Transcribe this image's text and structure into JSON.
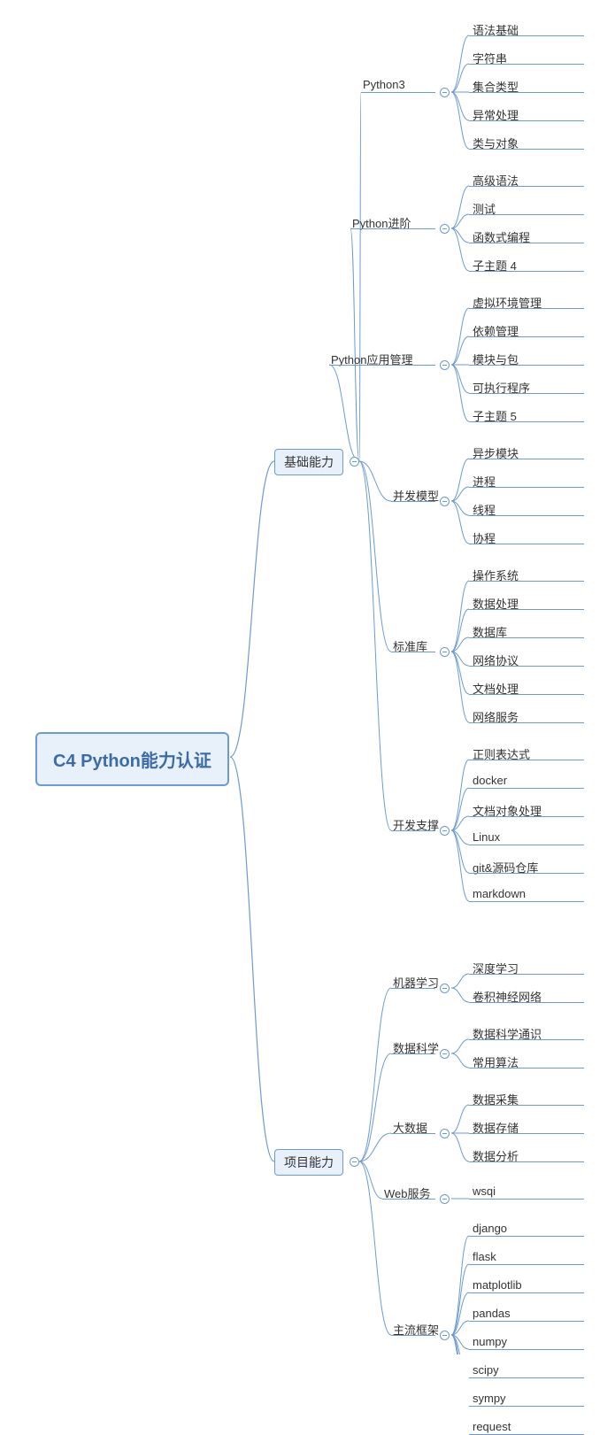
{
  "root": {
    "label": "C4 Python能力认证"
  },
  "branches": [
    {
      "label": "基础能力",
      "children": [
        {
          "label": "Python3",
          "children": [
            {
              "label": "语法基础"
            },
            {
              "label": "字符串"
            },
            {
              "label": "集合类型"
            },
            {
              "label": "异常处理"
            },
            {
              "label": "类与对象"
            }
          ]
        },
        {
          "label": "Python进阶",
          "children": [
            {
              "label": "高级语法"
            },
            {
              "label": "测试"
            },
            {
              "label": "函数式编程"
            },
            {
              "label": "子主题 4"
            }
          ]
        },
        {
          "label": "Python应用管理",
          "children": [
            {
              "label": "虚拟环境管理"
            },
            {
              "label": "依赖管理"
            },
            {
              "label": "模块与包"
            },
            {
              "label": "可执行程序"
            },
            {
              "label": "子主题 5"
            }
          ]
        },
        {
          "label": "并发模型",
          "children": [
            {
              "label": "异步模块"
            },
            {
              "label": "进程"
            },
            {
              "label": "线程"
            },
            {
              "label": "协程"
            }
          ]
        },
        {
          "label": "标准库",
          "children": [
            {
              "label": "操作系统"
            },
            {
              "label": "数据处理"
            },
            {
              "label": "数据库"
            },
            {
              "label": "网络协议"
            },
            {
              "label": "文档处理"
            },
            {
              "label": "网络服务"
            }
          ]
        },
        {
          "label": "开发支撑",
          "children": [
            {
              "label": "正则表达式"
            },
            {
              "label": "docker"
            },
            {
              "label": "文档对象处理"
            },
            {
              "label": "Linux"
            },
            {
              "label": "git&源码仓库"
            },
            {
              "label": "markdown"
            }
          ]
        }
      ]
    },
    {
      "label": "项目能力",
      "children": [
        {
          "label": "机器学习",
          "children": [
            {
              "label": "深度学习"
            },
            {
              "label": "卷积神经网络"
            }
          ]
        },
        {
          "label": "数据科学",
          "children": [
            {
              "label": "数据科学通识"
            },
            {
              "label": "常用算法"
            }
          ]
        },
        {
          "label": "大数据",
          "children": [
            {
              "label": "数据采集"
            },
            {
              "label": "数据存储"
            },
            {
              "label": "数据分析"
            }
          ]
        },
        {
          "label": "Web服务",
          "children": [
            {
              "label": "wsqi"
            }
          ]
        },
        {
          "label": "主流框架",
          "children": [
            {
              "label": "django"
            },
            {
              "label": "flask"
            },
            {
              "label": "matplotlib"
            },
            {
              "label": "pandas"
            },
            {
              "label": "numpy"
            },
            {
              "label": "scipy"
            },
            {
              "label": "sympy"
            },
            {
              "label": "request"
            }
          ]
        }
      ]
    }
  ]
}
